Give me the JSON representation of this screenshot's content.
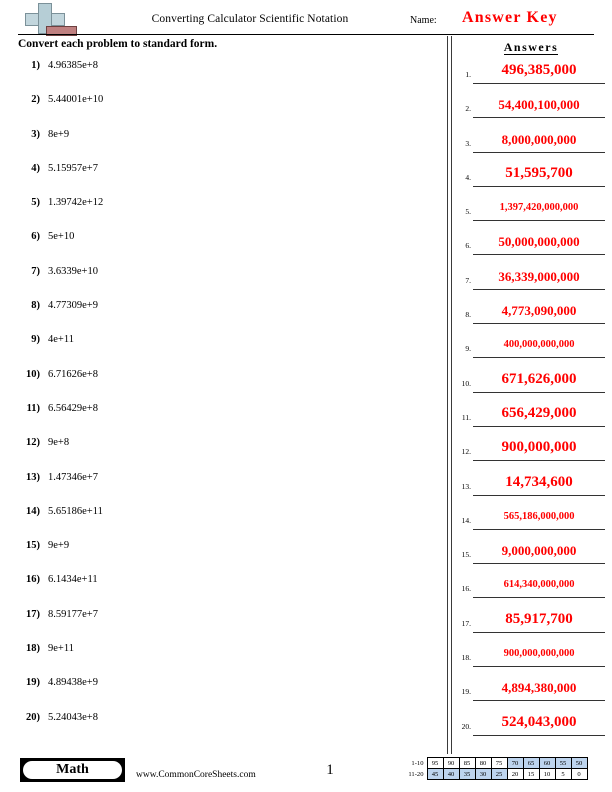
{
  "header": {
    "title": "Converting Calculator Scientific Notation",
    "name_label": "Name:",
    "answer_key": "Answer Key",
    "logo_icon": "plus-block-logo"
  },
  "instruction": "Convert each problem to standard form.",
  "answers_heading": "Answers",
  "problems": [
    {
      "num": "1)",
      "value": "4.96385e+8"
    },
    {
      "num": "2)",
      "value": "5.44001e+10"
    },
    {
      "num": "3)",
      "value": "8e+9"
    },
    {
      "num": "4)",
      "value": "5.15957e+7"
    },
    {
      "num": "5)",
      "value": "1.39742e+12"
    },
    {
      "num": "6)",
      "value": "5e+10"
    },
    {
      "num": "7)",
      "value": "3.6339e+10"
    },
    {
      "num": "8)",
      "value": "4.77309e+9"
    },
    {
      "num": "9)",
      "value": "4e+11"
    },
    {
      "num": "10)",
      "value": "6.71626e+8"
    },
    {
      "num": "11)",
      "value": "6.56429e+8"
    },
    {
      "num": "12)",
      "value": "9e+8"
    },
    {
      "num": "13)",
      "value": "1.47346e+7"
    },
    {
      "num": "14)",
      "value": "5.65186e+11"
    },
    {
      "num": "15)",
      "value": "9e+9"
    },
    {
      "num": "16)",
      "value": "6.1434e+11"
    },
    {
      "num": "17)",
      "value": "8.59177e+7"
    },
    {
      "num": "18)",
      "value": "9e+11"
    },
    {
      "num": "19)",
      "value": "4.89438e+9"
    },
    {
      "num": "20)",
      "value": "5.24043e+8"
    }
  ],
  "answers": [
    {
      "num": "1.",
      "value": "496,385,000",
      "size": "sz-lg"
    },
    {
      "num": "2.",
      "value": "54,400,100,000",
      "size": "sz-md"
    },
    {
      "num": "3.",
      "value": "8,000,000,000",
      "size": "sz-md"
    },
    {
      "num": "4.",
      "value": "51,595,700",
      "size": "sz-lg"
    },
    {
      "num": "5.",
      "value": "1,397,420,000,000",
      "size": "sz-sm"
    },
    {
      "num": "6.",
      "value": "50,000,000,000",
      "size": "sz-md"
    },
    {
      "num": "7.",
      "value": "36,339,000,000",
      "size": "sz-md"
    },
    {
      "num": "8.",
      "value": "4,773,090,000",
      "size": "sz-md"
    },
    {
      "num": "9.",
      "value": "400,000,000,000",
      "size": "sz-sm"
    },
    {
      "num": "10.",
      "value": "671,626,000",
      "size": "sz-lg"
    },
    {
      "num": "11.",
      "value": "656,429,000",
      "size": "sz-lg"
    },
    {
      "num": "12.",
      "value": "900,000,000",
      "size": "sz-lg"
    },
    {
      "num": "13.",
      "value": "14,734,600",
      "size": "sz-lg"
    },
    {
      "num": "14.",
      "value": "565,186,000,000",
      "size": "sz-sm"
    },
    {
      "num": "15.",
      "value": "9,000,000,000",
      "size": "sz-md"
    },
    {
      "num": "16.",
      "value": "614,340,000,000",
      "size": "sz-sm"
    },
    {
      "num": "17.",
      "value": "85,917,700",
      "size": "sz-lg"
    },
    {
      "num": "18.",
      "value": "900,000,000,000",
      "size": "sz-sm"
    },
    {
      "num": "19.",
      "value": "4,894,380,000",
      "size": "sz-md"
    },
    {
      "num": "20.",
      "value": "524,043,000",
      "size": "sz-lg"
    }
  ],
  "footer": {
    "subject": "Math",
    "site": "www.CommonCoreSheets.com",
    "page_number": "1"
  },
  "grading_scale": {
    "row1_label": "1-10",
    "row2_label": "11-20",
    "row1": [
      {
        "v": "95",
        "hl": false
      },
      {
        "v": "90",
        "hl": false
      },
      {
        "v": "85",
        "hl": false
      },
      {
        "v": "80",
        "hl": false
      },
      {
        "v": "75",
        "hl": false
      },
      {
        "v": "70",
        "hl": true
      },
      {
        "v": "65",
        "hl": true
      },
      {
        "v": "60",
        "hl": true
      },
      {
        "v": "55",
        "hl": true
      },
      {
        "v": "50",
        "hl": true
      }
    ],
    "row2": [
      {
        "v": "45",
        "hl": true
      },
      {
        "v": "40",
        "hl": true
      },
      {
        "v": "35",
        "hl": true
      },
      {
        "v": "30",
        "hl": true
      },
      {
        "v": "25",
        "hl": true
      },
      {
        "v": "20",
        "hl": false
      },
      {
        "v": "15",
        "hl": false
      },
      {
        "v": "10",
        "hl": false
      },
      {
        "v": "5",
        "hl": false
      },
      {
        "v": "0",
        "hl": false
      }
    ]
  },
  "colors": {
    "answer_red": "#ff0000",
    "highlight_blue": "#bdd4ee",
    "logo_blue": "#b6ced6",
    "logo_red": "#bf8080"
  }
}
